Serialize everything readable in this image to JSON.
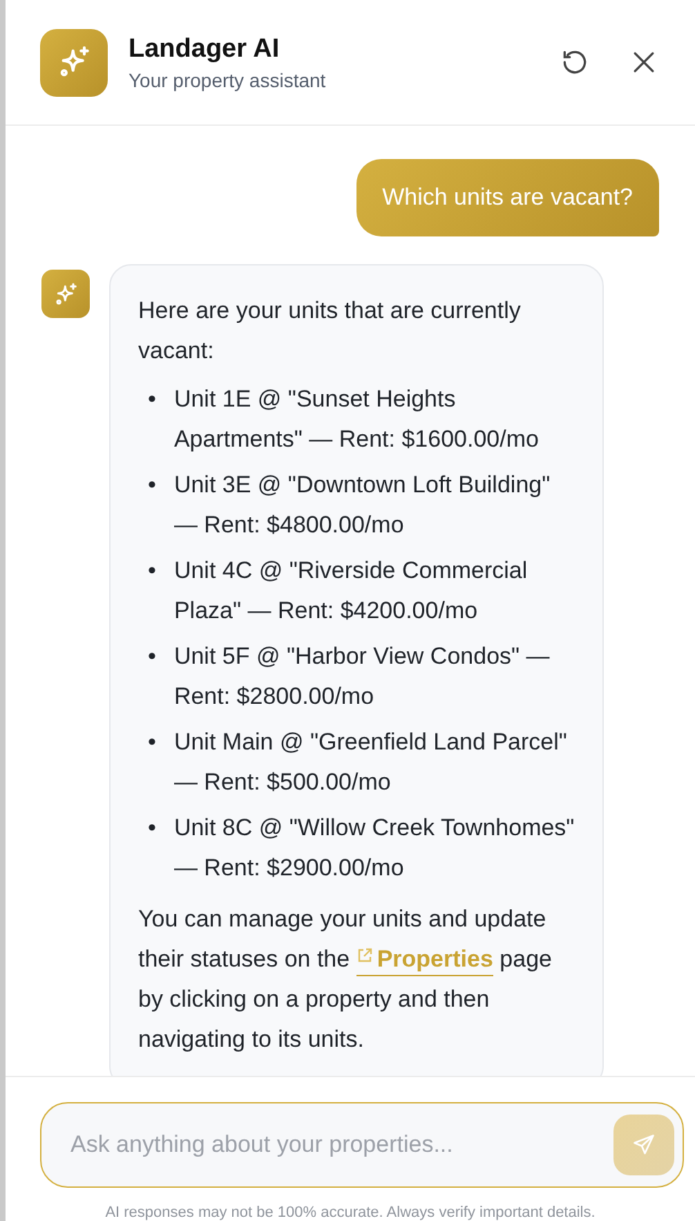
{
  "header": {
    "title": "Landager AI",
    "subtitle": "Your property assistant"
  },
  "messages": [
    {
      "kind": "user",
      "text": "Which units are vacant?"
    },
    {
      "kind": "assistant",
      "intro": "Here are your units that are currently vacant:",
      "items": [
        {
          "bullet": "•",
          "text": "Unit 1E @ \"Sunset Heights Apartments\" — Rent: $1600.00/mo"
        },
        {
          "bullet": "•",
          "text": "Unit 3E @ \"Downtown Loft Building\" — Rent: $4800.00/mo"
        },
        {
          "bullet": "•",
          "text": "Unit 4C @ \"Riverside Commercial Plaza\" — Rent: $4200.00/mo"
        },
        {
          "bullet": "•",
          "text": "Unit 5F @ \"Harbor View Condos\" — Rent: $2800.00/mo"
        },
        {
          "bullet": "•",
          "text": "Unit Main @ \"Greenfield Land Parcel\" — Rent: $500.00/mo"
        },
        {
          "bullet": "•",
          "text": "Unit 8C @ \"Willow Creek Townhomes\" — Rent: $2900.00/mo"
        }
      ],
      "closing": {
        "before": "You can manage your units and update their statuses on the",
        "link": "Properties",
        "after": "page by clicking on a property and then navigating to its units."
      }
    }
  ],
  "composer": {
    "placeholder": "Ask anything about your properties...",
    "send_disabled": true
  },
  "disclaimer": "AI responses may not be 100% accurate. Always verify important details."
}
